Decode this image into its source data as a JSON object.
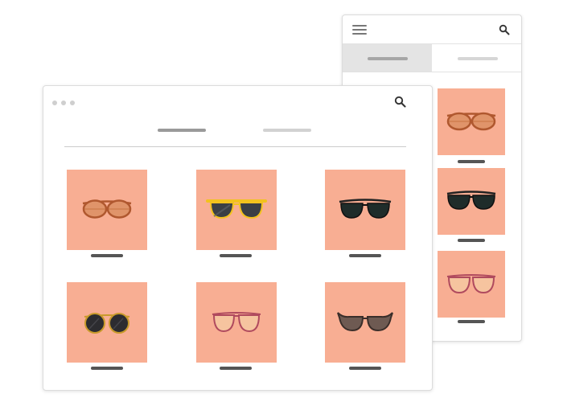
{
  "colors": {
    "tile_background": "#f8ae93",
    "label_placeholder": "#555555",
    "active_tab": "#9a9a9a",
    "inactive_tab": "#d2d2d2",
    "window_border": "#dcdcdc"
  },
  "mobile": {
    "icons": [
      "hamburger-menu-icon",
      "search-icon"
    ],
    "tabs": [
      {
        "state": "selected"
      },
      {
        "state": "unselected"
      }
    ],
    "products": [
      {
        "icon": "round-tinted-sunglasses-icon"
      },
      {
        "icon": "black-aviator-sunglasses-icon"
      },
      {
        "icon": "pink-rimmed-glasses-icon"
      }
    ]
  },
  "desktop": {
    "icons": [
      "window-dots-icon",
      "search-icon"
    ],
    "tabs": [
      {
        "state": "selected"
      },
      {
        "state": "unselected"
      }
    ],
    "products": [
      {
        "icon": "round-tinted-sunglasses-icon"
      },
      {
        "icon": "yellow-frame-sunglasses-icon"
      },
      {
        "icon": "black-aviator-sunglasses-icon"
      },
      {
        "icon": "round-black-sunglasses-icon"
      },
      {
        "icon": "pink-rimmed-glasses-icon"
      },
      {
        "icon": "cat-eye-sunglasses-icon"
      }
    ]
  }
}
